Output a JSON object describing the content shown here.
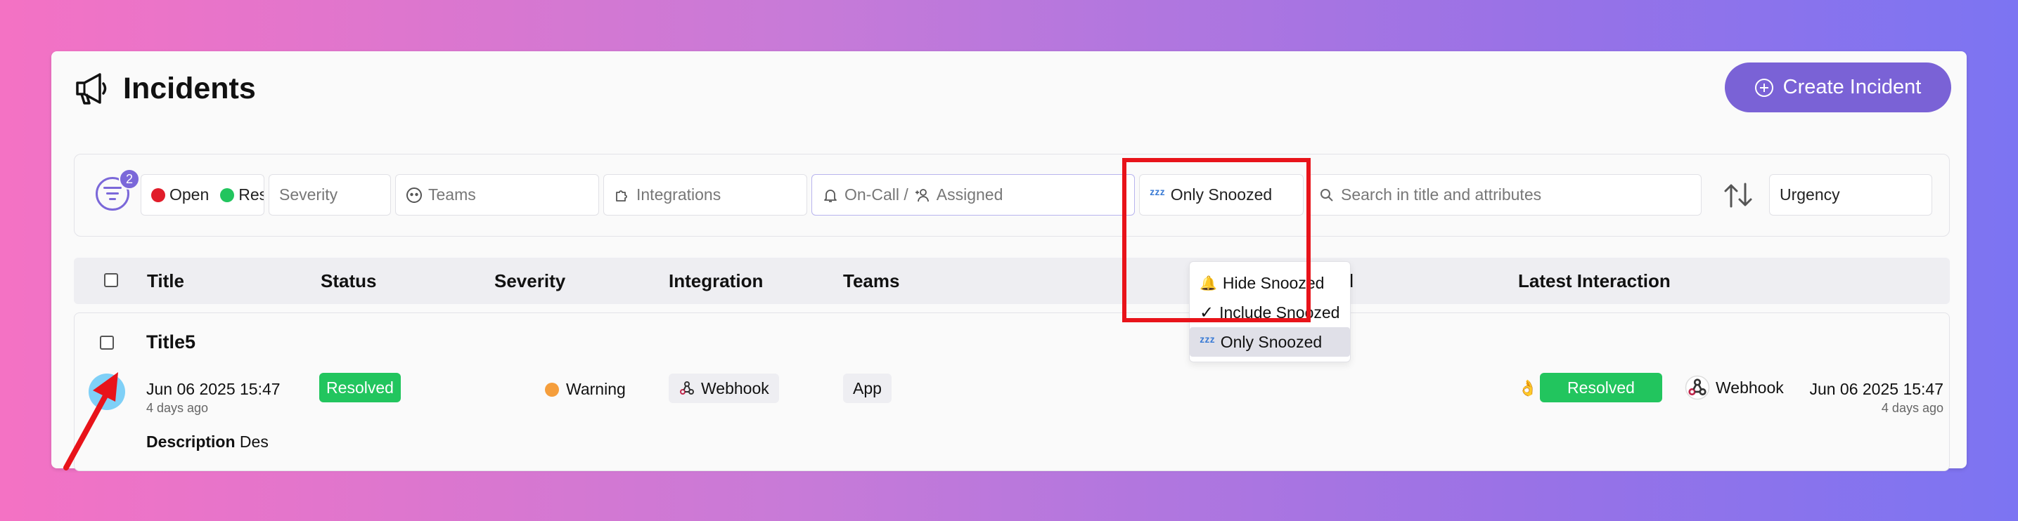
{
  "header": {
    "title": "Incidents",
    "create_label": "Create Incident"
  },
  "filters": {
    "active_count": "2",
    "status": {
      "items": [
        {
          "label": "Open",
          "color": "#e11d2a"
        },
        {
          "label": "Res",
          "color": "#22c55e"
        }
      ]
    },
    "severity_placeholder": "Severity",
    "teams_placeholder": "Teams",
    "integrations_placeholder": "Integrations",
    "oncall_label": "On-Call /",
    "assigned_label": "Assigned",
    "snooze_selected": "Only Snoozed",
    "search_placeholder": "Search in title and attributes",
    "sort_value": "Urgency"
  },
  "snooze_menu": {
    "options": [
      "Hide Snoozed",
      "Include Snoozed",
      "Only Snoozed"
    ],
    "checked": "Include Snoozed",
    "highlighted": "Only Snoozed"
  },
  "table": {
    "columns": {
      "title": "Title",
      "status": "Status",
      "severity": "Severity",
      "integration": "Integration",
      "teams": "Teams",
      "assigned": "gned",
      "latest": "Latest Interaction"
    },
    "rows": [
      {
        "title": "Title5",
        "created_date": "Jun 06 2025 15:47",
        "created_ago": "4 days ago",
        "status": "Resolved",
        "severity": "Warning",
        "integration": "Webhook",
        "team": "App",
        "description_label": "Description",
        "description": "Des",
        "latest": {
          "status": "Resolved",
          "source": "Webhook",
          "date": "Jun 06 2025 15:47",
          "ago": "4 days ago"
        }
      }
    ]
  },
  "colors": {
    "accent": "#7a62d6",
    "success": "#22c55e",
    "warning": "#f59e3c",
    "highlight": "#e8131a",
    "snooze": "#7fd0f7"
  }
}
